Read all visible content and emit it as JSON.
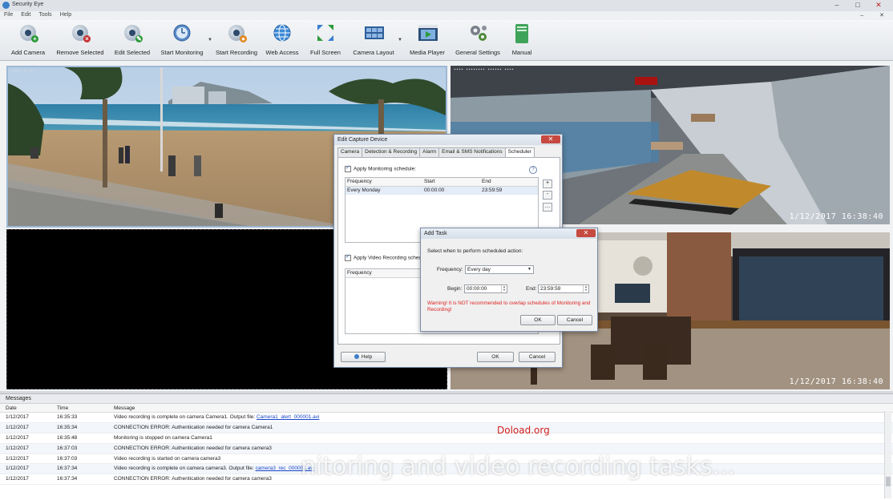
{
  "window": {
    "title": "Security Eye"
  },
  "menu": [
    "File",
    "Edit",
    "Tools",
    "Help"
  ],
  "toolbar": {
    "add_camera": "Add Camera",
    "remove_selected": "Remove Selected",
    "edit_selected": "Edit Selected",
    "start_monitoring": "Start Monitoring",
    "start_recording": "Start Recording",
    "web_access": "Web Access",
    "full_screen": "Full Screen",
    "camera_layout": "Camera Layout",
    "media_player": "Media Player",
    "general_settings": "General Settings",
    "manual": "Manual"
  },
  "cameras": {
    "cam1_stamp": "",
    "cam2_stamp": "1/12/2017  16:38:40",
    "cam4_stamp": "1/12/2017  16:38:40"
  },
  "edit_dialog": {
    "title": "Edit Capture Device",
    "tabs": [
      "Camera",
      "Detection & Recording",
      "Alarm",
      "Email & SMS Notifications",
      "Scheduler"
    ],
    "apply_monitoring": "Apply Monitoring schedule:",
    "col_frequency": "Frequency",
    "col_start": "Start",
    "col_end": "End",
    "row_frequency": "Every Monday",
    "row_start": "00:00:00",
    "row_end": "23:59:59",
    "apply_recording": "Apply Video Recording schedule:",
    "help": "Help",
    "ok": "OK",
    "cancel": "Cancel",
    "question": "?"
  },
  "add_task": {
    "title": "Add Task",
    "prompt": "Select when to perform scheduled action:",
    "frequency_label": "Frequency:",
    "frequency_value": "Every day",
    "begin_label": "Begin:",
    "begin_value": "00:00:00",
    "end_label": "End:",
    "end_value": "23:59:59",
    "warning": "Warning! It is NOT recommended to overlap schedules of Monitoring and Recording!",
    "ok": "OK",
    "cancel": "Cancel"
  },
  "messages": {
    "title": "Messages",
    "headers": {
      "date": "Date",
      "time": "Time",
      "message": "Message"
    },
    "rows": [
      {
        "date": "1/12/2017",
        "time": "16:35:33",
        "message": "Video recording is complete on camera Camera1. Output file: ",
        "file": "Camera1_alert_000001.avi"
      },
      {
        "date": "1/12/2017",
        "time": "16:35:34",
        "message": "CONNECTION ERROR: Authentication needed for camera Camera1",
        "file": ""
      },
      {
        "date": "1/12/2017",
        "time": "16:35:48",
        "message": "Monitoring is stopped on camera Camera1",
        "file": ""
      },
      {
        "date": "1/12/2017",
        "time": "16:37:03",
        "message": "CONNECTION ERROR: Authentication needed for camera camera3",
        "file": ""
      },
      {
        "date": "1/12/2017",
        "time": "16:37:03",
        "message": "Video recording is started on camera camera3",
        "file": ""
      },
      {
        "date": "1/12/2017",
        "time": "16:37:34",
        "message": "Video recording is complete on camera camera3. Output file: ",
        "file": "camera3_rec_000001.avi"
      },
      {
        "date": "1/12/2017",
        "time": "16:37:34",
        "message": "CONNECTION ERROR: Authentication needed for camera camera3",
        "file": ""
      }
    ]
  },
  "overlay": {
    "watermark": "Doload.org",
    "subtitle": "nitoring and video recording tasks..."
  }
}
